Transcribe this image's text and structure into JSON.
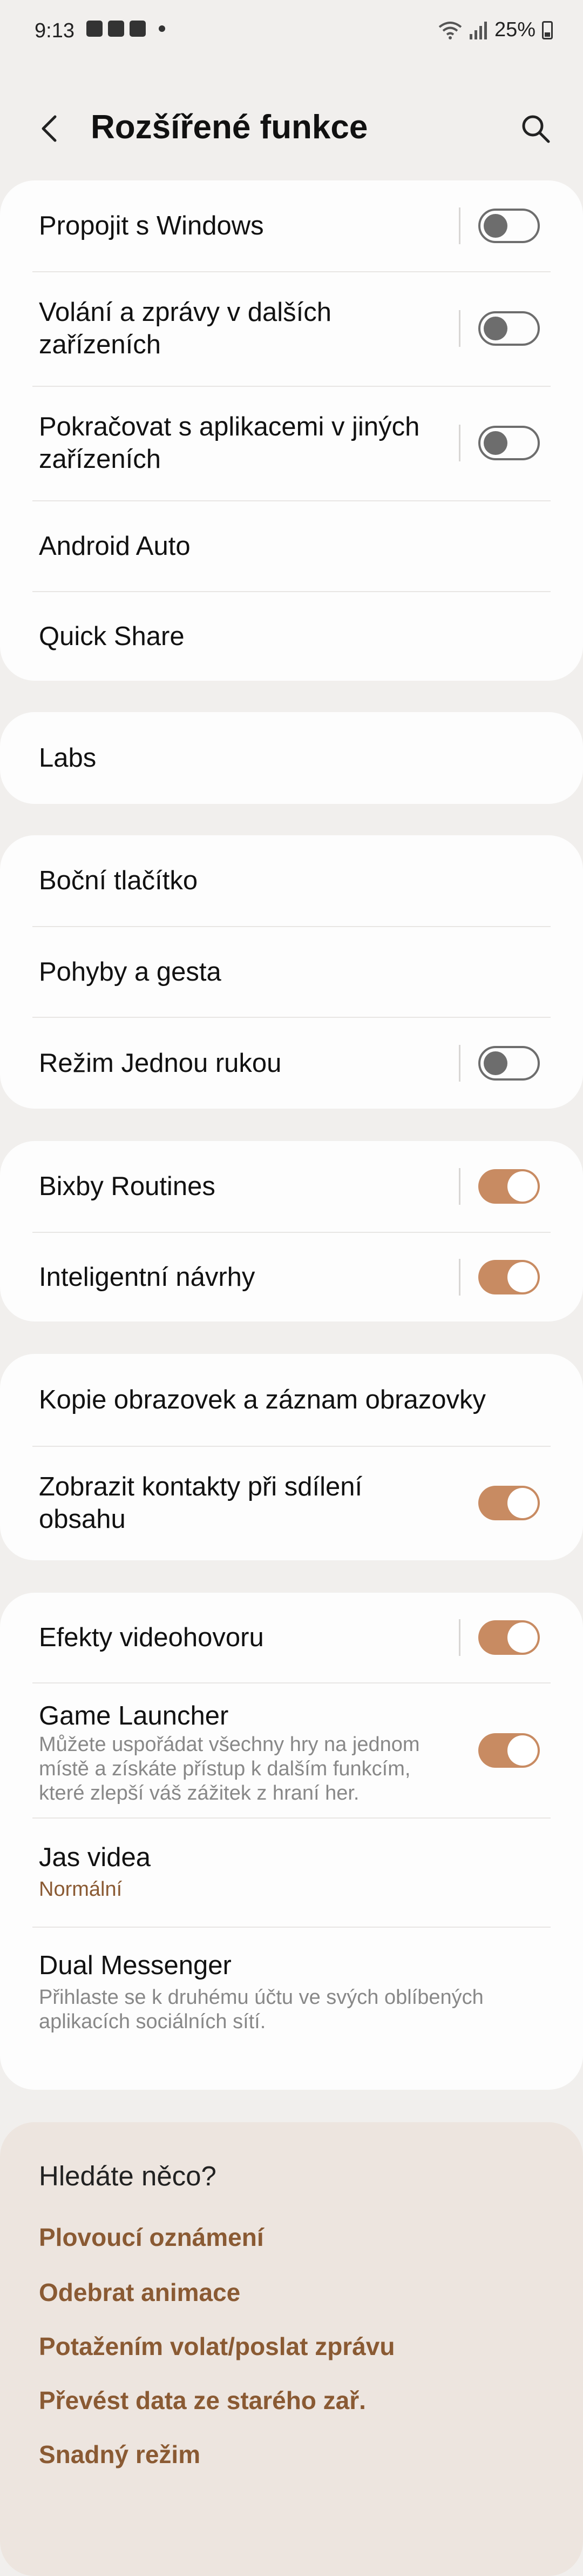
{
  "status_bar": {
    "time": "9:13",
    "battery": "25%"
  },
  "app_bar": {
    "title": "Rozšířené funkce"
  },
  "group1": {
    "items": [
      {
        "label": "Propojit s Windows"
      },
      {
        "label_line1": "Volání a zprávy v dalších",
        "label_line2": "zařízeních"
      },
      {
        "label_line1": "Pokračovat s aplikacemi v jiných",
        "label_line2": "zařízeních"
      },
      {
        "label": "Android Auto"
      },
      {
        "label": "Quick Share"
      }
    ]
  },
  "group2": {
    "items": [
      {
        "label": "Labs"
      }
    ]
  },
  "group3": {
    "items": [
      {
        "label": "Boční tlačítko"
      },
      {
        "label": "Pohyby a gesta"
      },
      {
        "label": "Režim Jednou rukou"
      }
    ]
  },
  "group4": {
    "items": [
      {
        "label": "Bixby Routines"
      },
      {
        "label": "Inteligentní návrhy"
      }
    ]
  },
  "group5": {
    "items": [
      {
        "label": "Kopie obrazovek a záznam obrazovky"
      },
      {
        "label_line1": "Zobrazit kontakty při sdílení",
        "label_line2": "obsahu"
      }
    ]
  },
  "group6": {
    "items": [
      {
        "label": "Efekty videohovoru"
      },
      {
        "label": "Game Launcher",
        "sub_line1": "Můžete uspořádat všechny hry na jednom",
        "sub_line2": "místě a získáte přístup k dalším funkcím,",
        "sub_line3": "které zlepší váš zážitek z hraní her."
      },
      {
        "label": "Jas videa",
        "value": "Normální"
      },
      {
        "label": "Dual Messenger",
        "sub_line1": "Přihlaste se k druhému účtu ve svých oblíbených",
        "sub_line2": "aplikacích sociálních sítí."
      }
    ]
  },
  "suggestions": {
    "heading": "Hledáte něco?",
    "links": [
      "Plovoucí oznámení",
      "Odebrat animace",
      "Potažením volat/poslat zprávu",
      "Převést data ze starého zař.",
      "Snadný režim"
    ]
  },
  "colors": {
    "accent": "#c88b62",
    "link": "#8a5a33",
    "background": "#f1efed",
    "card": "#fdfdfd"
  }
}
